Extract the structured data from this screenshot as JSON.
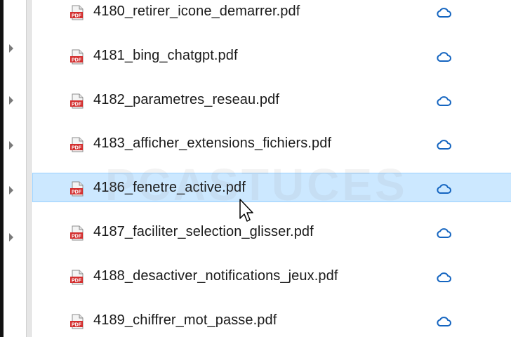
{
  "files": [
    {
      "name": "4180_retirer_icone_demarrer.pdf",
      "icon": "pdf-file-icon",
      "status_icon": "cloud-icon",
      "selected": false
    },
    {
      "name": "4181_bing_chatgpt.pdf",
      "icon": "pdf-file-icon",
      "status_icon": "cloud-icon",
      "selected": false
    },
    {
      "name": "4182_parametres_reseau.pdf",
      "icon": "pdf-file-icon",
      "status_icon": "cloud-icon",
      "selected": false
    },
    {
      "name": "4183_afficher_extensions_fichiers.pdf",
      "icon": "pdf-file-icon",
      "status_icon": "cloud-icon",
      "selected": false
    },
    {
      "name": "4186_fenetre_active.pdf",
      "icon": "pdf-file-icon",
      "status_icon": "cloud-icon",
      "selected": true
    },
    {
      "name": "4187_faciliter_selection_glisser.pdf",
      "icon": "pdf-file-icon",
      "status_icon": "cloud-icon",
      "selected": false
    },
    {
      "name": "4188_desactiver_notifications_jeux.pdf",
      "icon": "pdf-file-icon",
      "status_icon": "cloud-icon",
      "selected": false
    },
    {
      "name": "4189_chiffrer_mot_passe.pdf",
      "icon": "pdf-file-icon",
      "status_icon": "cloud-icon",
      "selected": false
    }
  ],
  "pdf_badge_text": "PDF",
  "watermark_text": "PCASTUCES",
  "colors": {
    "selection_bg": "#cce8ff",
    "selection_border": "#99d1ff",
    "pdf_red": "#d32f2f",
    "cloud_blue": "#1565c0"
  }
}
